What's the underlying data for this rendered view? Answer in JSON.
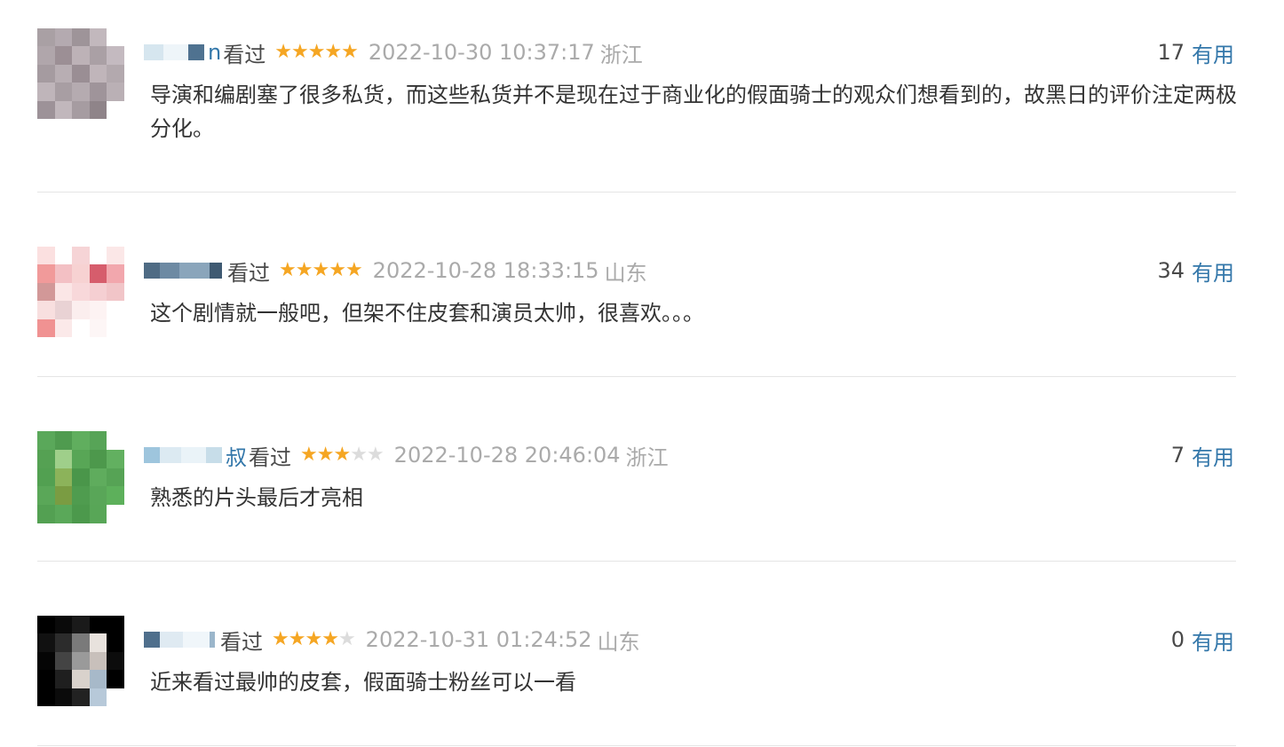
{
  "comments": [
    {
      "name_tail": "n",
      "status": "看过",
      "rating": 5,
      "time": "2022-10-30 10:37:17",
      "location": "浙江",
      "votes": "17",
      "vote_label": "有用",
      "text": "导演和编剧塞了很多私货，而这些私货并不是现在过于商业化的假面骑士的观众们想看到的，故黑日的评价注定两极分化。"
    },
    {
      "name_tail": "",
      "status": "看过",
      "rating": 5,
      "time": "2022-10-28 18:33:15",
      "location": "山东",
      "votes": "34",
      "vote_label": "有用",
      "text": "这个剧情就一般吧，但架不住皮套和演员太帅，很喜欢。。。"
    },
    {
      "name_tail": "叔",
      "status": "看过",
      "rating": 3,
      "time": "2022-10-28 20:46:04",
      "location": "浙江",
      "votes": "7",
      "vote_label": "有用",
      "text": "熟悉的片头最后才亮相"
    },
    {
      "name_tail": "",
      "status": "看过",
      "rating": 4,
      "time": "2022-10-31 01:24:52",
      "location": "山东",
      "votes": "0",
      "vote_label": "有用",
      "text": "近来看过最帅的皮套，假面骑士粉丝可以一看"
    }
  ]
}
